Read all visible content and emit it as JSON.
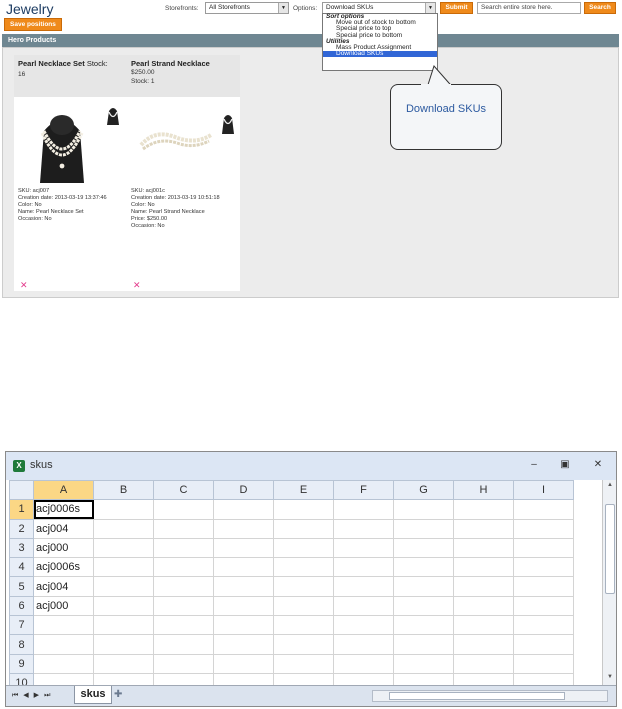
{
  "admin": {
    "title": "Jewelry",
    "save_positions": "Save positions",
    "storefronts_label": "Storefronts:",
    "storefronts_value": "All Storefronts",
    "options_label": "Options:",
    "options_value": "Download SKUs",
    "submit": "Submit",
    "search_placeholder": "Search entire store here.",
    "search": "Search",
    "hero_title": "Hero Products",
    "dropdown": {
      "group_sort": "Sort options",
      "sort_options": [
        "Move out of stock to bottom",
        "Special price to top",
        "Special price to bottom"
      ],
      "group_utilities": "Utilities",
      "utility_options": [
        "Mass Product Assignment",
        "Download SKUs"
      ]
    },
    "callout": "Download SKUs",
    "cards": [
      {
        "title": "Pearl Necklace Set",
        "stock_label": "Stock:",
        "stock_value": "16",
        "sku": "SKU: acj007",
        "creation": "Creation date: 2013-03-19 13:37:46",
        "color": "Color: No",
        "name": "Name: Pearl Necklace Set",
        "occasion": "Occasion: No"
      },
      {
        "title": "Pearl Strand Necklace",
        "price": "$250.00",
        "stock": "Stock: 1",
        "sku": "SKU: acj001c",
        "creation": "Creation date: 2013-03-19 10:51:18",
        "color": "Color: No",
        "name": "Name: Pearl Strand Necklace",
        "price_line": "Price: $250.00",
        "occasion": "Occasion: No"
      }
    ]
  },
  "excel": {
    "title": "skus",
    "columns": [
      "A",
      "B",
      "C",
      "D",
      "E",
      "F",
      "G",
      "H",
      "I"
    ],
    "rows": [
      "1",
      "2",
      "3",
      "4",
      "5",
      "6",
      "7",
      "8",
      "9",
      "10"
    ],
    "cells_a": [
      "acj0006s",
      "acj004",
      "acj000",
      "acj0006s",
      "acj004",
      "acj000",
      "",
      "",
      "",
      ""
    ],
    "sheet_tab": "skus"
  }
}
